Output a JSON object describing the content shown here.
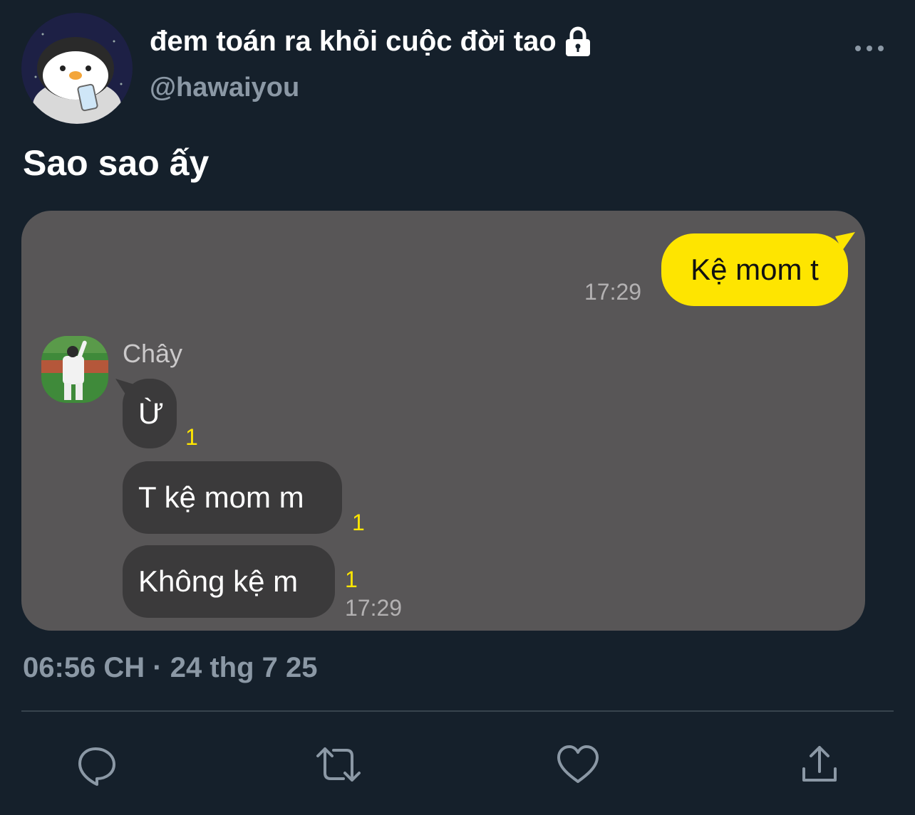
{
  "tweet": {
    "display_name": "đem toán ra khỏi cuộc đời tao",
    "handle": "@hawaiyou",
    "text": "Sao sao ấy",
    "timestamp": "06:56 CH · 24 thg 7 25"
  },
  "chat": {
    "sent_message": "Kệ mom t",
    "sent_time": "17:29",
    "sender_name": "Chây",
    "messages": [
      {
        "text": "Ừ",
        "unread": "1"
      },
      {
        "text": "T kệ mom m",
        "unread": "1"
      },
      {
        "text": "Không kệ m",
        "unread": "1"
      }
    ],
    "received_time": "17:29"
  },
  "colors": {
    "background": "#15202b",
    "chat_background": "#585657",
    "sent_bubble": "#fee500",
    "received_bubble": "#3b3a3b",
    "muted_text": "#8b98a5"
  },
  "icons": [
    "lock-icon",
    "more-icon",
    "reply-icon",
    "retweet-icon",
    "like-icon",
    "share-icon"
  ]
}
